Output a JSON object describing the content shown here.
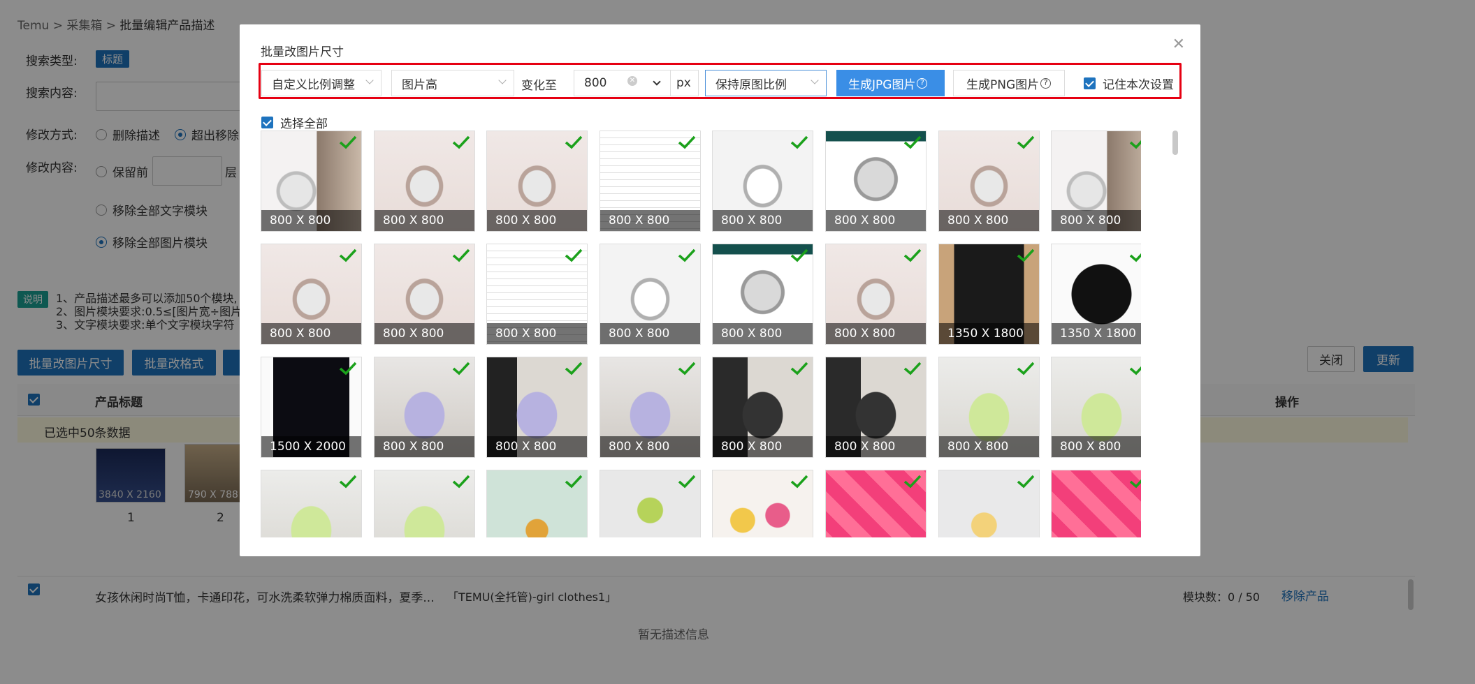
{
  "breadcrumb": {
    "items": [
      "Temu",
      "采集箱",
      "批量编辑产品描述"
    ],
    "separator": ">"
  },
  "form": {
    "search_type_label": "搜索类型:",
    "search_type_tag": "标题",
    "search_content_label": "搜索内容:",
    "modify_mode_label": "修改方式:",
    "modify_mode_opt1": "删除描述",
    "modify_mode_opt2": "超出移除",
    "modify_content_label": "修改内容:",
    "keep_before": "保留前",
    "layer_suffix": "层",
    "remove_text": "移除全部文字模块",
    "remove_image": "移除全部图片模块"
  },
  "notes": {
    "tag": "说明",
    "lines": [
      "1、产品描述最多可以添加50个模块,",
      "2、图片模块要求:0.5≤[图片宽÷图片",
      "3、文字模块要求:单个文字模块字符"
    ]
  },
  "actions": {
    "batch_resize": "批量改图片尺寸",
    "batch_format": "批量改格式",
    "close": "关闭",
    "update": "更新"
  },
  "table": {
    "col_title": "产品标题",
    "col_ops": "操作",
    "selected_info": "已选中50条数据",
    "row1_thumbs": [
      {
        "dim": "3840 X 2160",
        "idx": "1"
      },
      {
        "dim": "790 X 788",
        "idx": "2"
      }
    ],
    "row2_title": "女孩休闲时尚T恤，卡通印花，可水洗柔软弹力棉质面料，夏季...",
    "row2_store": "「TEMU(全托管)-girl clothes1」",
    "row2_modules": "模块数：0 / 50",
    "row2_remove": "移除产品",
    "row2_empty": "暂无描述信息"
  },
  "modal": {
    "title": "批量改图片尺寸",
    "close_icon": "close-icon",
    "toolbar": {
      "mode": "自定义比例调整",
      "target": "图片高",
      "change_to": "变化至",
      "value": "800",
      "unit": "px",
      "ratio": "保持原图比例",
      "gen_jpg": "生成JPG图片",
      "gen_png": "生成PNG图片",
      "remember": "记住本次设置"
    },
    "select_all": "选择全部",
    "images": [
      {
        "dim": "800 X 800",
        "kind": "ring-romance"
      },
      {
        "dim": "800 X 800",
        "kind": "ring"
      },
      {
        "dim": "800 X 800",
        "kind": "ring"
      },
      {
        "dim": "800 X 800",
        "kind": "size-chart"
      },
      {
        "dim": "800 X 800",
        "kind": "ring-white"
      },
      {
        "dim": "800 X 800",
        "kind": "moissanite"
      },
      {
        "dim": "800 X 800",
        "kind": "ring"
      },
      {
        "dim": "800 X 800",
        "kind": "ring-romance"
      },
      {
        "dim": "800 X 800",
        "kind": "ring"
      },
      {
        "dim": "800 X 800",
        "kind": "ring"
      },
      {
        "dim": "800 X 800",
        "kind": "size-chart"
      },
      {
        "dim": "800 X 800",
        "kind": "ring-white"
      },
      {
        "dim": "800 X 800",
        "kind": "moissanite"
      },
      {
        "dim": "800 X 800",
        "kind": "ring"
      },
      {
        "dim": "1350 X 1800",
        "kind": "tshirt-man"
      },
      {
        "dim": "1350 X 1800",
        "kind": "tshirt"
      },
      {
        "dim": "1500 X 2000",
        "kind": "black-cloth"
      },
      {
        "dim": "800 X 800",
        "kind": "cat-purple"
      },
      {
        "dim": "800 X 800",
        "kind": "cat-purple-dark"
      },
      {
        "dim": "800 X 800",
        "kind": "cat-purple"
      },
      {
        "dim": "800 X 800",
        "kind": "cat-black"
      },
      {
        "dim": "800 X 800",
        "kind": "cat-black"
      },
      {
        "dim": "800 X 800",
        "kind": "cat-green"
      },
      {
        "dim": "800 X 800",
        "kind": "cat-green"
      },
      {
        "dim": "",
        "kind": "cat-green"
      },
      {
        "dim": "",
        "kind": "cat-green"
      },
      {
        "dim": "",
        "kind": "keychain"
      },
      {
        "dim": "",
        "kind": "keychain-scale"
      },
      {
        "dim": "",
        "kind": "toys"
      },
      {
        "dim": "",
        "kind": "pink-cards"
      },
      {
        "dim": "",
        "kind": "toy-white"
      },
      {
        "dim": "",
        "kind": "pink-cards"
      }
    ]
  },
  "colors": {
    "primary": "#1e73be",
    "highlight": "#e60012",
    "check": "#1ba11b"
  }
}
